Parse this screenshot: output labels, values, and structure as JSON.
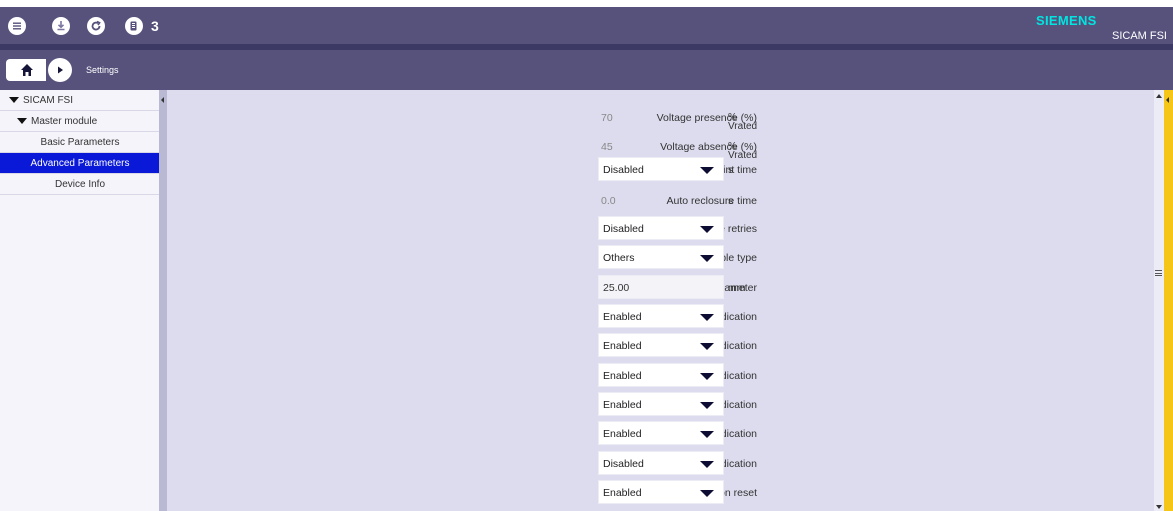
{
  "toolbar": {
    "badge_count": "3",
    "icons": [
      "menu-icon",
      "download-icon",
      "refresh-icon",
      "device-icon"
    ]
  },
  "brand": {
    "logo": "SIEMENS",
    "product": "SICAM FSI"
  },
  "nav": {
    "breadcrumb": "Settings"
  },
  "sidebar": {
    "items": [
      {
        "label": "SICAM FSI",
        "level": 0,
        "expanded": true
      },
      {
        "label": "Master module",
        "level": 1,
        "expanded": true
      },
      {
        "label": "Basic Parameters",
        "level": 2
      },
      {
        "label": "Advanced Parameters",
        "level": 2,
        "active": true
      },
      {
        "label": "Device Info",
        "level": 2
      }
    ]
  },
  "form": {
    "rows": [
      {
        "label": "Voltage presence (%)",
        "type": "text",
        "value": "70",
        "unit_line1": "%",
        "unit_line2": "Vrated"
      },
      {
        "label": "Voltage absence (%)",
        "type": "text",
        "value": "45",
        "unit_line1": "%",
        "unit_line2": "Vrated"
      },
      {
        "label": "Inrush restraint time",
        "type": "select",
        "value": "Disabled",
        "unit": "s"
      },
      {
        "label": "Auto reclosure time",
        "type": "text",
        "value": "0.0",
        "unit": "s"
      },
      {
        "label": "Auto reclosure retries",
        "type": "select",
        "value": "Disabled"
      },
      {
        "label": "Cable type",
        "type": "select",
        "value": "Others"
      },
      {
        "label": "Cable diameter",
        "type": "input",
        "value": "25.00",
        "unit": "mm"
      },
      {
        "label": "Temporary phase-fault indication",
        "type": "select",
        "value": "Enabled"
      },
      {
        "label": "Permanent phase-fault indication",
        "type": "select",
        "value": "Enabled"
      },
      {
        "label": "Temporary DI-fault indication",
        "type": "select",
        "value": "Enabled"
      },
      {
        "label": "Permanent DI-fault indication",
        "type": "select",
        "value": "Enabled"
      },
      {
        "label": "Battery-low indication",
        "type": "select",
        "value": "Enabled"
      },
      {
        "label": "Wireless failure indication",
        "type": "select",
        "value": "Disabled"
      },
      {
        "label": "Voltage restoration reset",
        "type": "select",
        "value": "Enabled"
      }
    ]
  },
  "colors": {
    "header_bg": "#56527c",
    "header_dark": "#3d3965",
    "main_bg": "#dcdcee",
    "active_item": "#0a18d8",
    "brand_teal": "#00e5e1",
    "accent_yellow": "#f5c518"
  }
}
